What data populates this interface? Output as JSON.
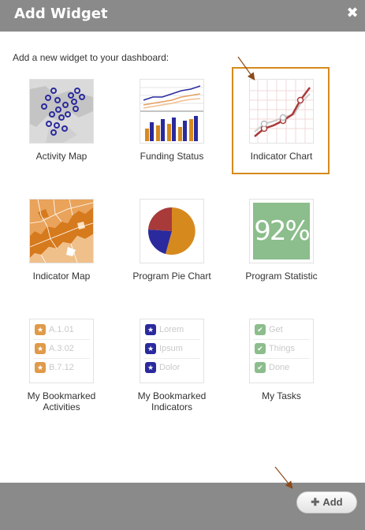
{
  "dialog": {
    "title": "Add Widget",
    "close_icon": "close-icon"
  },
  "intro": "Add a new widget to your dashboard:",
  "widgets": [
    {
      "label": "Activity Map",
      "icon": "activity-map-icon"
    },
    {
      "label": "Funding Status",
      "icon": "funding-status-icon"
    },
    {
      "label": "Indicator Chart",
      "icon": "indicator-chart-icon",
      "selected": true
    },
    {
      "label": "Indicator Map",
      "icon": "indicator-map-icon"
    },
    {
      "label": "Program Pie Chart",
      "icon": "program-pie-chart-icon"
    },
    {
      "label": "Program Statistic",
      "icon": "program-statistic-icon",
      "value": "92%"
    },
    {
      "label": "My Bookmarked Activities",
      "icon": "bookmarked-activities-icon",
      "items": [
        "A.1.01",
        "A.3.02",
        "B.7.12"
      ]
    },
    {
      "label": "My Bookmarked Indicators",
      "icon": "bookmarked-indicators-icon",
      "items": [
        "Lorem",
        "Ipsum",
        "Dolor"
      ]
    },
    {
      "label": "My Tasks",
      "icon": "tasks-icon",
      "items": [
        "Get",
        "Things",
        "Done"
      ]
    }
  ],
  "footer": {
    "add_label": "Add"
  },
  "colors": {
    "header": "#8a8a8a",
    "accent": "#d68a1e",
    "navy": "#2a2a9e",
    "green": "#8cbd8c",
    "red": "#a83a3a"
  }
}
